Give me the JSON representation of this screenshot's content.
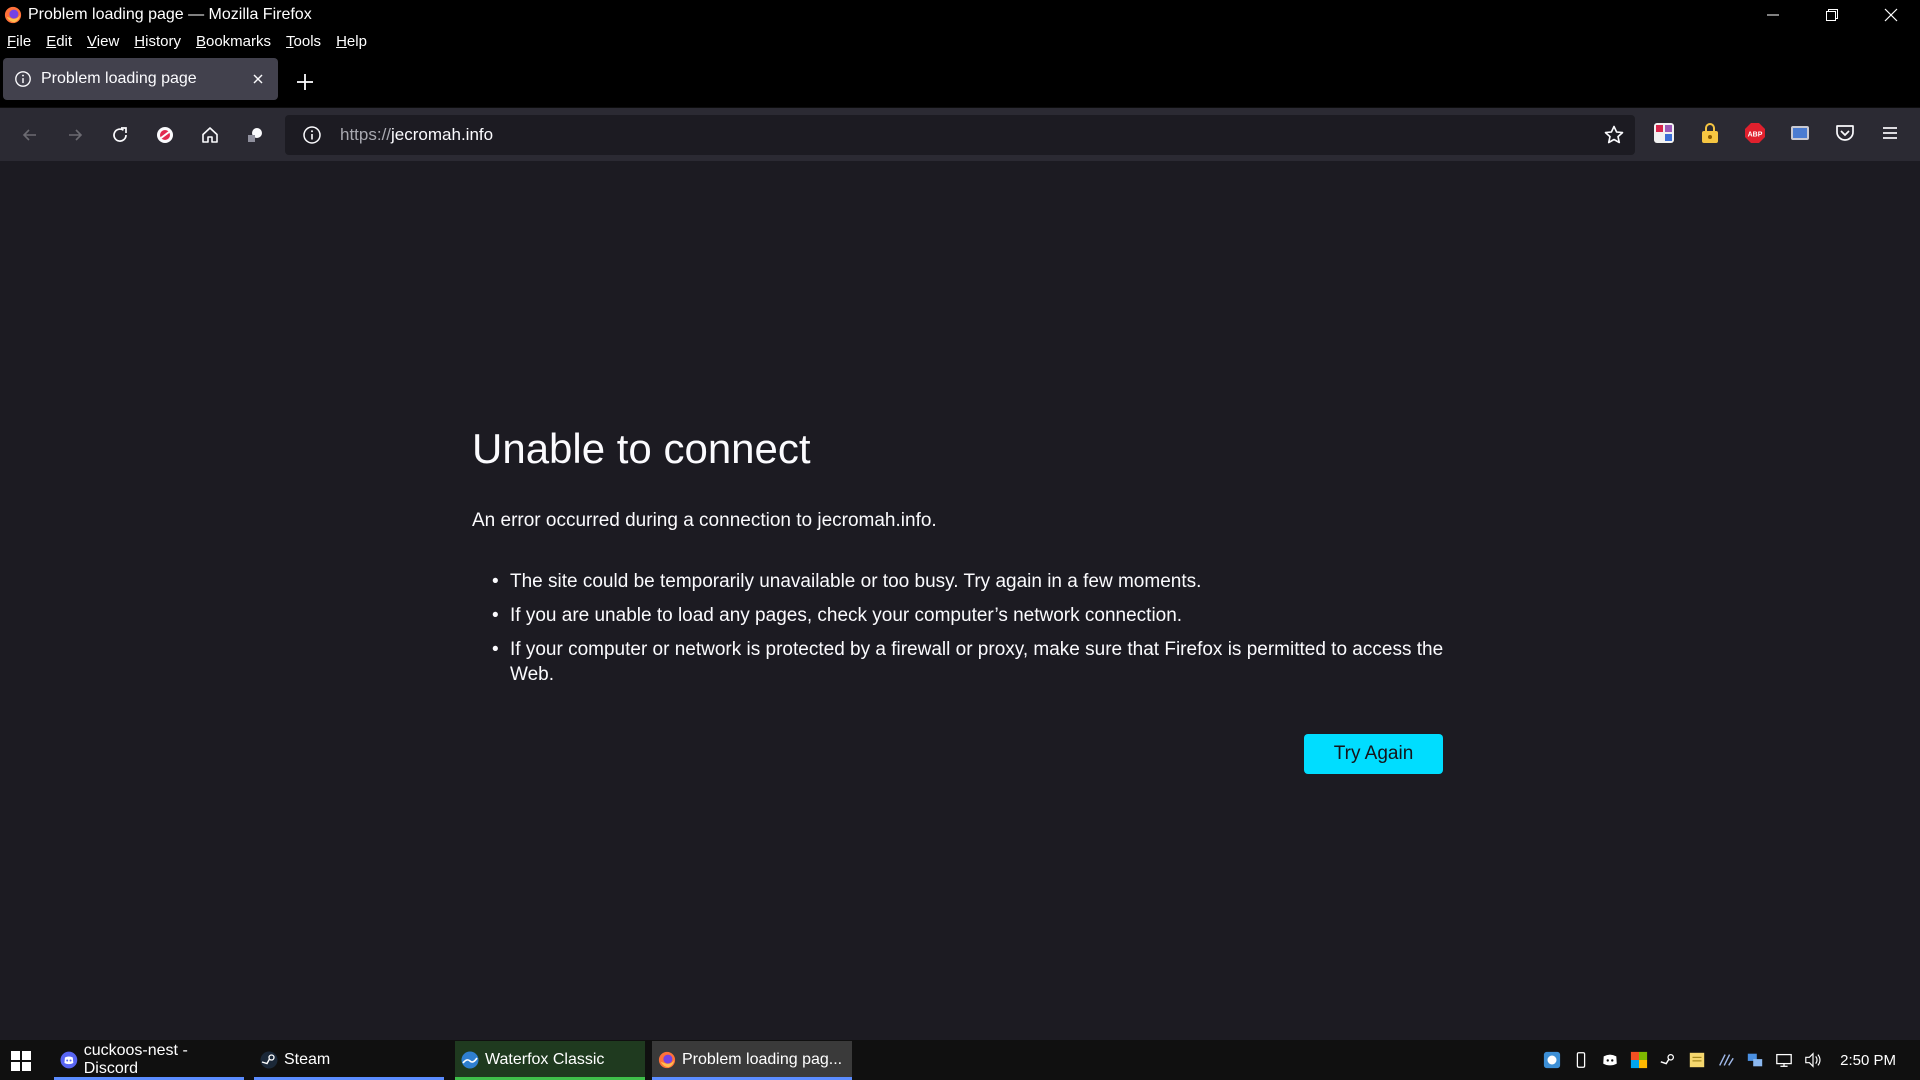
{
  "window": {
    "title": "Problem loading page — Mozilla Firefox",
    "controls": [
      "minimize-icon",
      "restore-icon",
      "close-icon"
    ]
  },
  "menu": {
    "items": [
      {
        "underline": "F",
        "rest": "ile"
      },
      {
        "underline": "E",
        "rest": "dit"
      },
      {
        "underline": "V",
        "rest": "iew"
      },
      {
        "underline": "H",
        "rest": "istory"
      },
      {
        "underline": "B",
        "rest": "ookmarks"
      },
      {
        "underline": "T",
        "rest": "ools"
      },
      {
        "underline": "H",
        "rest": "elp"
      }
    ]
  },
  "tab": {
    "title": "Problem loading page"
  },
  "address": {
    "scheme": "https://",
    "host": "jecromah.info"
  },
  "error": {
    "title": "Unable to connect",
    "description": "An error occurred during a connection to jecromah.info.",
    "bullets": [
      "The site could be temporarily unavailable or too busy. Try again in a few moments.",
      "If you are unable to load any pages, check your computer’s network connection.",
      "If your computer or network is protected by a firewall or proxy, make sure that Firefox is permitted to access the Web."
    ],
    "button": "Try Again"
  },
  "taskbar": {
    "items": [
      {
        "label": "cuckoos-nest - Discord",
        "icon": "discord-icon",
        "accent": "#5b8cff"
      },
      {
        "label": "Steam",
        "icon": "steam-icon",
        "accent": "#5b8cff"
      },
      {
        "label": "Waterfox Classic",
        "icon": "waterfox-icon",
        "accent": "#3fbf4a"
      },
      {
        "label": "Problem loading pag...",
        "icon": "firefox-icon",
        "accent": "#5b8cff"
      }
    ],
    "clock": "2:50 PM"
  },
  "colors": {
    "content_bg": "#1c1b22",
    "toolbar_bg": "#2b2a33",
    "button_accent": "#00ddff"
  }
}
